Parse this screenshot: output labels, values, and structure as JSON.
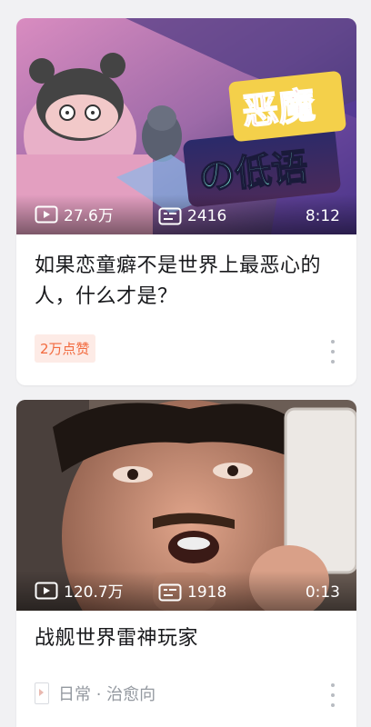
{
  "feed": {
    "videos": [
      {
        "thumbnail_text": "恶魔的低语",
        "plays": "27.6万",
        "danmaku": "2416",
        "duration": "8:12",
        "title": "如果恋童癖不是世界上最恶心的人，什么才是？",
        "likes_tag": "2万点赞",
        "more_icon": "more-vertical-icon"
      },
      {
        "plays": "120.7万",
        "danmaku": "1918",
        "duration": "0:13",
        "title": "战舰世界雷神玩家",
        "channel": "日常 · 治愈向",
        "more_icon": "more-vertical-icon"
      }
    ]
  },
  "colors": {
    "accent_orange": "#f26a3e",
    "tag_bg": "#fdebe6",
    "text_primary": "#18191c",
    "text_secondary": "#9499a0"
  }
}
